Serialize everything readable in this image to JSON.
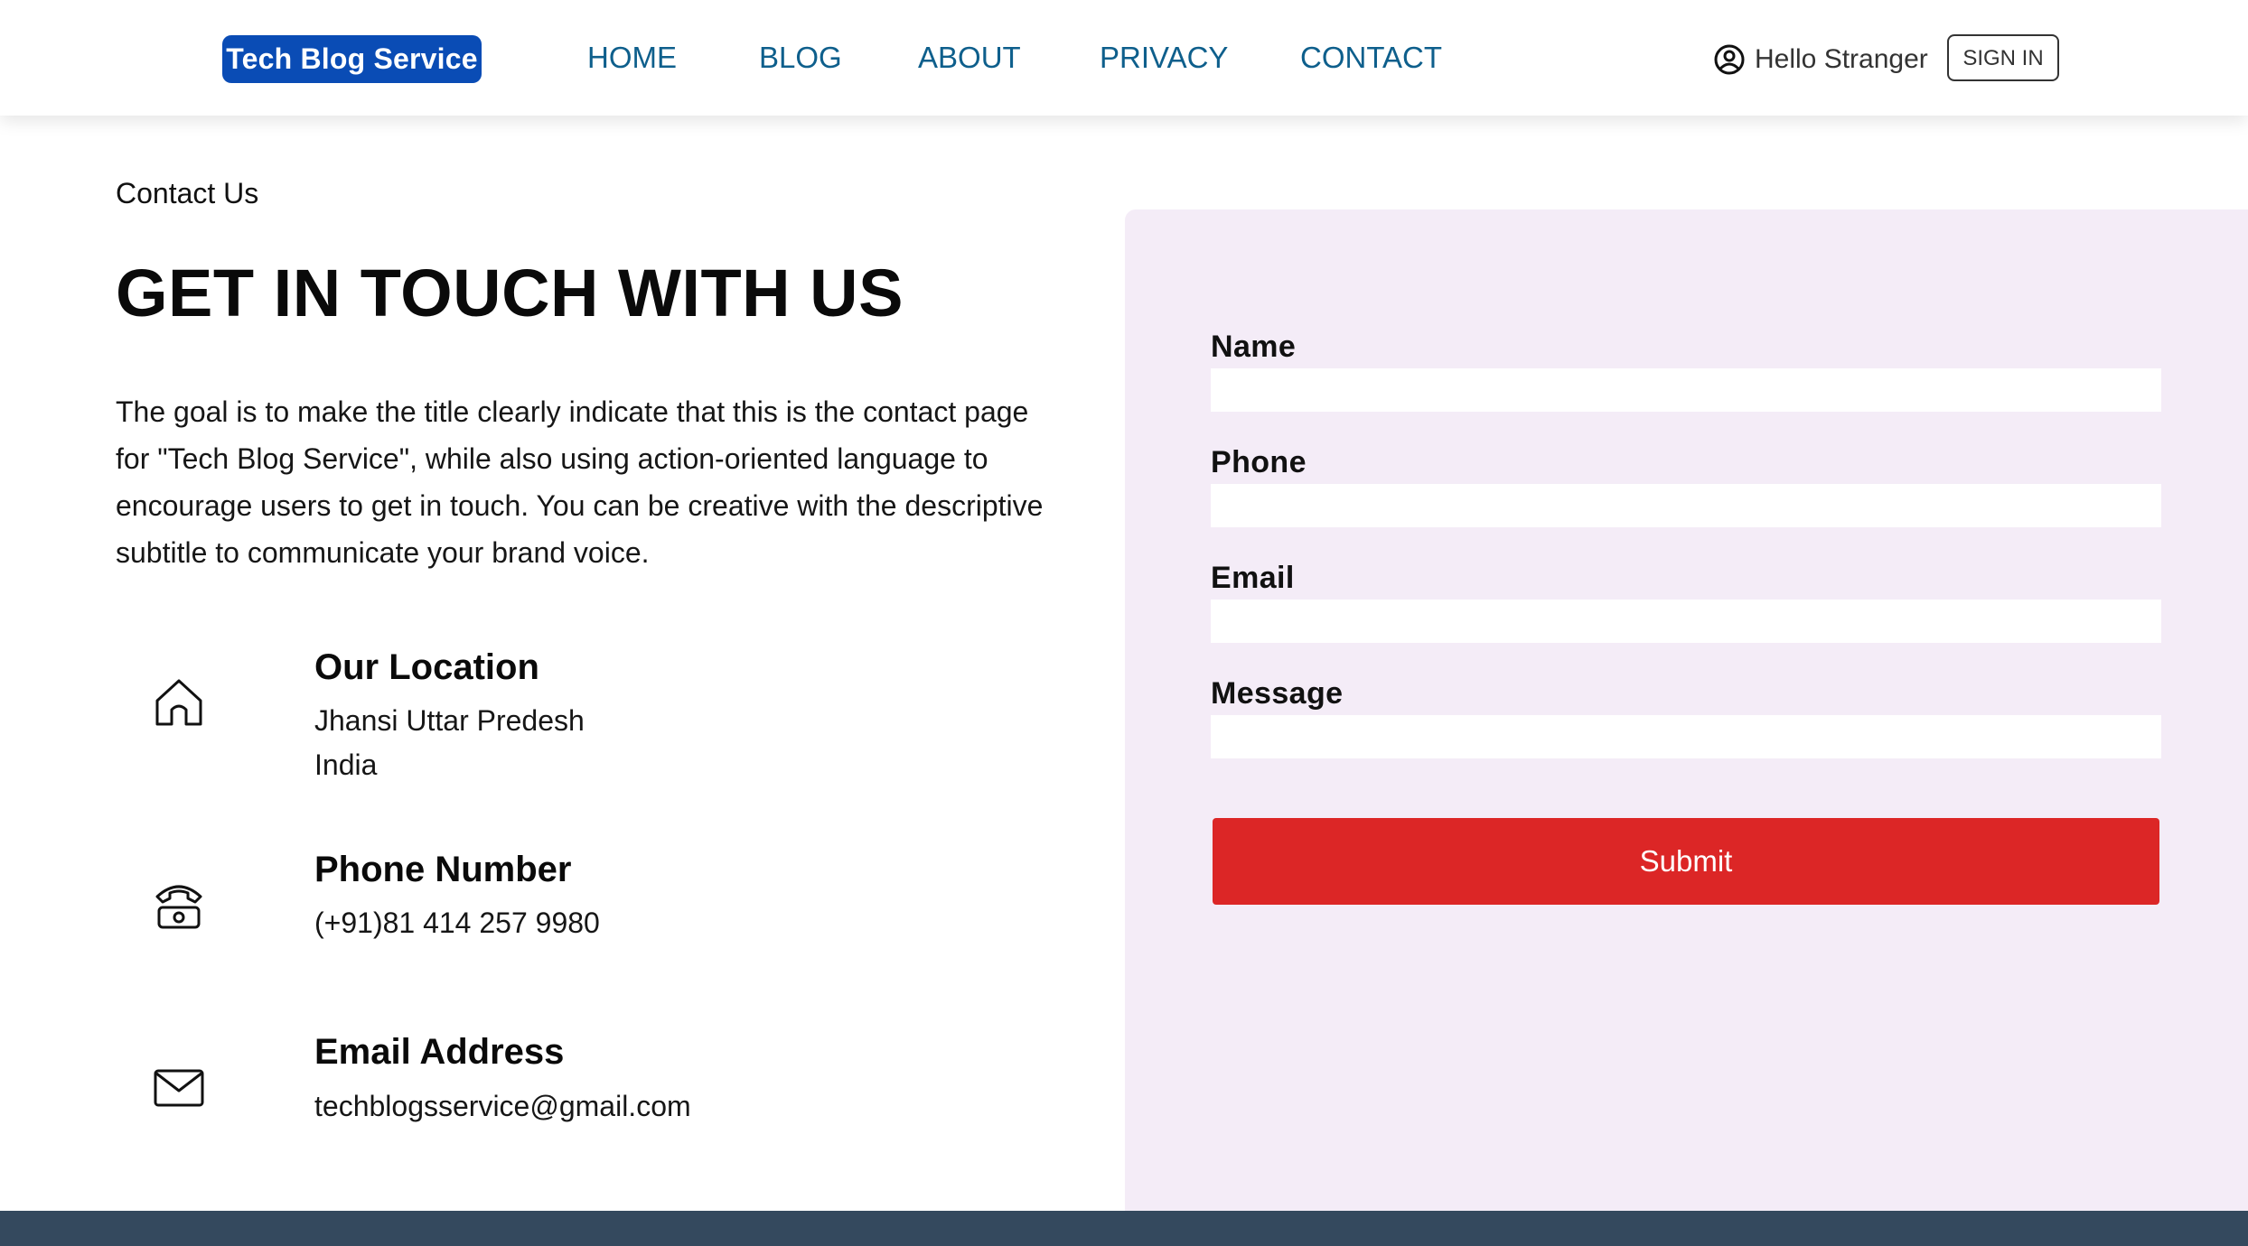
{
  "header": {
    "logo_text": "Tech Blog Service",
    "nav": [
      "HOME",
      "BLOG",
      "ABOUT",
      "PRIVACY",
      "CONTACT"
    ],
    "greeting": "Hello Stranger",
    "signin_label": "SIGN IN"
  },
  "contact": {
    "breadcrumb": "Contact Us",
    "heading": "GET IN TOUCH WITH US",
    "description": "The goal is to make the title clearly indicate that this is the contact page for \"Tech Blog Service\", while also using action-oriented language to encourage users to get in touch. You can be creative with the descriptive subtitle to communicate your brand voice.",
    "location": {
      "title": "Our Location",
      "line1": "Jhansi Uttar Predesh",
      "line2": "India",
      "icon": "home-icon"
    },
    "phone": {
      "title": "Phone Number",
      "value": "(+91)81 414 257 9980",
      "icon": "telephone-icon"
    },
    "email": {
      "title": "Email Address",
      "value": "techblogsservice@gmail.com",
      "icon": "envelope-icon"
    }
  },
  "form": {
    "fields": [
      {
        "label": "Name",
        "value": ""
      },
      {
        "label": "Phone",
        "value": ""
      },
      {
        "label": "Email",
        "value": ""
      },
      {
        "label": "Message",
        "value": ""
      }
    ],
    "submit_label": "Submit"
  },
  "colors": {
    "brand": "#0a4cb5",
    "nav_link": "#0e5f8c",
    "form_panel": "#f4ecf7",
    "submit": "#dc2626",
    "footer": "#34495e"
  }
}
